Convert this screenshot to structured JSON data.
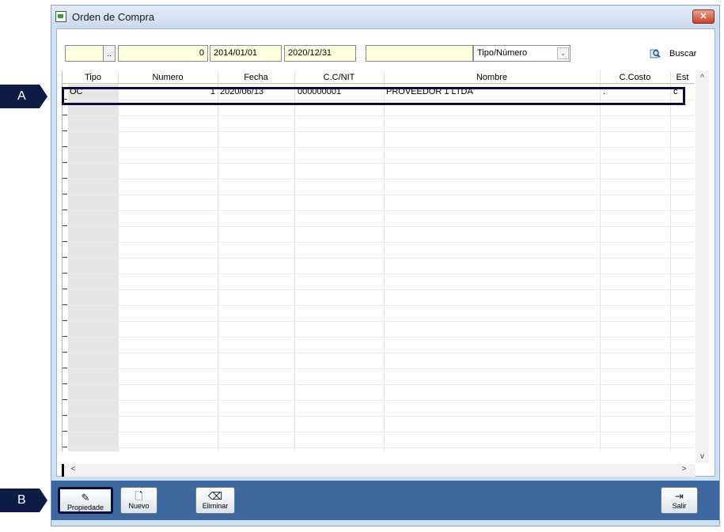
{
  "window": {
    "title": "Orden de Compra",
    "close_glyph": "✕"
  },
  "filters": {
    "type_code": "",
    "dots_label": "..",
    "number": "0",
    "date_from": "2014/01/01",
    "date_to": "2020/12/31",
    "text": "",
    "order_by": "Tipo/Número",
    "search_label": "Buscar"
  },
  "grid": {
    "columns": [
      "Tipo",
      "Numero",
      "Fecha",
      "C.C/NIT",
      "Nombre",
      "C.Costo",
      "Est"
    ],
    "rows": [
      {
        "tipo": "OC",
        "numero": "1",
        "fecha": "2020/06/13",
        "nit": "000000001",
        "nombre": "PROVEEDOR 1 LTDA",
        "ccosto": ".",
        "est": "c"
      }
    ]
  },
  "scrollbars": {
    "up": "^",
    "down": "v",
    "left": "<",
    "right": ">"
  },
  "toolbar": {
    "propiedades": "Propiedade",
    "nuevo": "Nuevo",
    "eliminar": "Eliminar",
    "salir": "Salir"
  },
  "markers": {
    "a": "A",
    "b": "B"
  },
  "icons": {
    "app": "document-icon",
    "search": "magnifier-icon",
    "propiedades": "properties-icon",
    "nuevo": "new-document-icon",
    "eliminar": "eraser-icon",
    "salir": "exit-door-icon"
  }
}
